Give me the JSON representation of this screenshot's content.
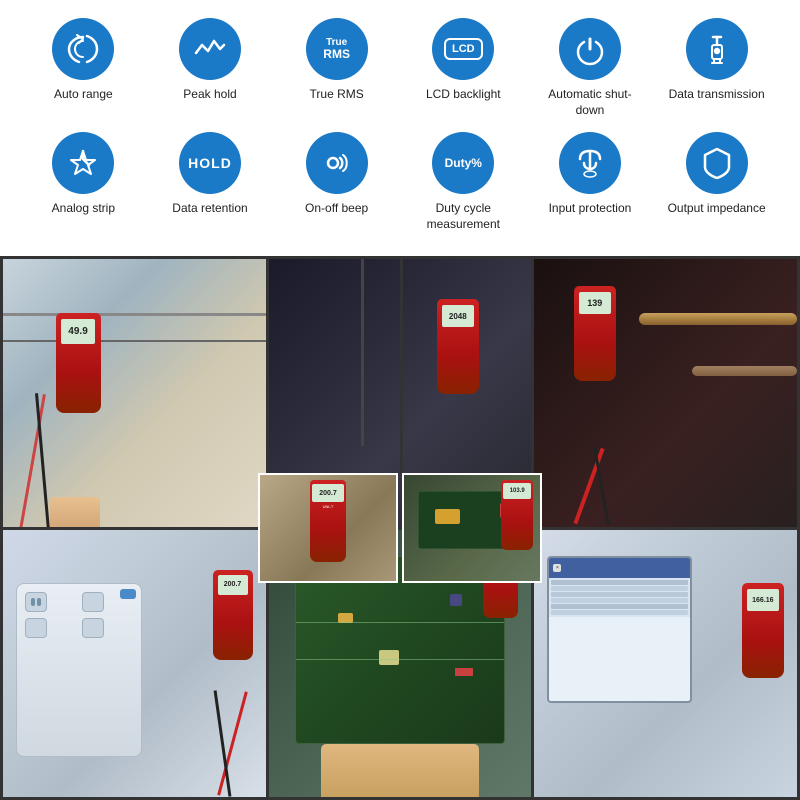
{
  "features": {
    "row1": [
      {
        "id": "auto-range",
        "label": "Auto range",
        "icon": "spiral"
      },
      {
        "id": "peak-hold",
        "label": "Peak hold",
        "icon": "wave"
      },
      {
        "id": "true-rms",
        "label": "True RMS",
        "icon": "truerms"
      },
      {
        "id": "lcd-backlight",
        "label": "LCD backlight",
        "icon": "lcd"
      },
      {
        "id": "auto-shutdown",
        "label": "Automatic shut-down",
        "icon": "power"
      },
      {
        "id": "data-transmission",
        "label": "Data transmission",
        "icon": "usb"
      }
    ],
    "row2": [
      {
        "id": "analog-strip",
        "label": "Analog strip",
        "icon": "compass"
      },
      {
        "id": "data-retention",
        "label": "Data retention",
        "icon": "hold"
      },
      {
        "id": "on-off-beep",
        "label": "On-off beep",
        "icon": "sound"
      },
      {
        "id": "duty-cycle",
        "label": "Duty cycle measurement",
        "icon": "duty"
      },
      {
        "id": "input-protection",
        "label": "Input protection",
        "icon": "umbrella"
      },
      {
        "id": "output-impedance",
        "label": "Output impedance",
        "icon": "shield"
      }
    ]
  },
  "photos": {
    "display_numbers": [
      "49.9",
      "2048",
      "139",
      "200.7",
      "103.9",
      "166.16"
    ],
    "grid_labels": [
      "photo1",
      "photo2",
      "photo3",
      "photo4",
      "photo5",
      "photo6"
    ]
  }
}
